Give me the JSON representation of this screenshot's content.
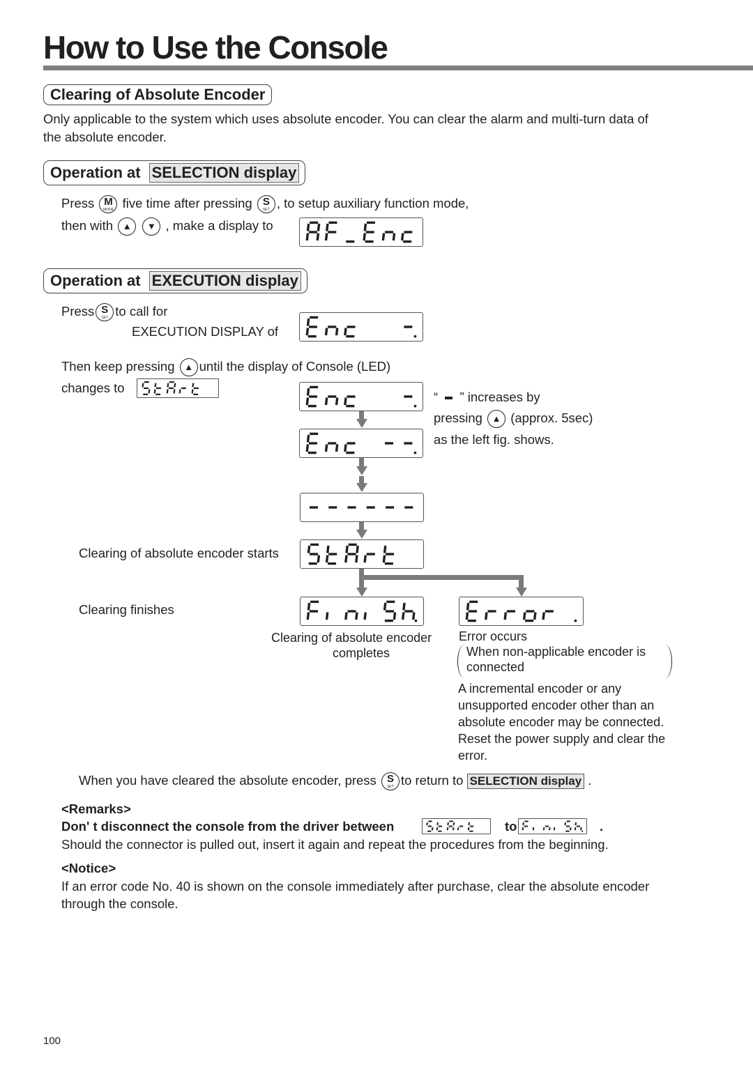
{
  "page": {
    "title": "How to Use the Console",
    "page_number": "100"
  },
  "section_clear": {
    "heading": "Clearing of Absolute Encoder",
    "intro_line1": "Only applicable to the system which uses absolute encoder. You can clear the alarm and multi-turn data of",
    "intro_line2": "the absolute encoder."
  },
  "section_selection": {
    "heading_prefix": "Operation at",
    "heading_tag": "SELECTION display",
    "line1_a": "Press",
    "line1_b": "five time after pressing",
    "line1_c": ", to setup auxiliary function mode,",
    "line2_a": "then with",
    "line2_b": ", make a display to",
    "display": "AF_Enc"
  },
  "section_execution": {
    "heading_prefix": "Operation at",
    "heading_tag": "EXECUTION display",
    "press_a": "Press",
    "press_b": "to call for",
    "exec_display_label": "EXECUTION DISPLAY of",
    "then_a": "Then keep pressing",
    "then_b": "until the display of Console (LED)",
    "changes_to": "changes to",
    "note_line1_open": "“",
    "note_line1_close": "” increases by",
    "note_line2_a": "pressing",
    "note_line2_b": "(approx. 5sec)",
    "note_line3": "as the left fig. shows.",
    "starts_label": "Clearing of absolute encoder starts",
    "finishes_label": "Clearing finishes",
    "complete_line1": "Clearing of absolute encoder",
    "complete_line2": "completes",
    "error_title": "Error occurs",
    "error_paren_line1": "When non-applicable encoder is",
    "error_paren_line2": "connected",
    "error_detail": [
      "A incremental encoder or any",
      "unsupported encoder other than an",
      "absolute encoder may be connected.",
      "Reset the power supply and clear the",
      "error."
    ],
    "return_a": "When you have cleared the absolute encoder, press",
    "return_b": "to return to",
    "return_tag": "SELECTION display",
    "return_end": "."
  },
  "buttons": {
    "mode": {
      "glyph": "M",
      "sub": "MODE",
      "icon": "mode-button-icon"
    },
    "set": {
      "glyph": "S",
      "sub": "SET",
      "icon": "set-button-icon"
    },
    "up": {
      "glyph": "▲",
      "icon": "up-button-icon"
    },
    "down": {
      "glyph": "▼",
      "icon": "down-button-icon"
    }
  },
  "remarks": {
    "heading": "<Remarks>",
    "bold_a": "Don' t disconnect the console from the driver between",
    "bold_b": "to",
    "bold_end": ".",
    "text": "Should the connector is pulled out, insert it again and repeat the procedures from the beginning."
  },
  "notice": {
    "heading": "<Notice>",
    "line1": "If an error code No. 40 is shown on the console immediately after purchase, clear the absolute encoder",
    "line2": "through the console."
  },
  "displays": {
    "af_enc": {
      "text": "AF_Enc",
      "digits": [
        "abcefg",
        "aefg",
        "d",
        "adefg",
        "ceg",
        "deg"
      ],
      "dp": [
        false,
        false,
        false,
        false,
        false,
        false
      ]
    },
    "enc1": {
      "text": "Enc   -.",
      "digits": [
        "adefg",
        "ceg",
        "deg",
        "",
        "",
        "g"
      ],
      "dp": [
        false,
        false,
        false,
        false,
        false,
        true
      ]
    },
    "enc2": {
      "text": "Enc  --.",
      "digits": [
        "adefg",
        "ceg",
        "deg",
        "",
        "g",
        "g"
      ],
      "dp": [
        false,
        false,
        false,
        false,
        false,
        true
      ]
    },
    "dashes": {
      "text": "------",
      "digits": [
        "g",
        "g",
        "g",
        "g",
        "g",
        "g"
      ],
      "dp": [
        false,
        false,
        false,
        false,
        false,
        false
      ]
    },
    "start": {
      "text": "StArt",
      "digits": [
        "acdfg",
        "defg",
        "abcefg",
        "eg",
        "defg",
        ""
      ],
      "dp": [
        false,
        false,
        false,
        false,
        false,
        false
      ]
    },
    "finish": {
      "text": "Finish.",
      "digits": [
        "aefg",
        "e",
        "ceg",
        "e",
        "acdfg",
        "cefg"
      ],
      "dp": [
        false,
        false,
        false,
        false,
        false,
        true
      ]
    },
    "error": {
      "text": "Error .",
      "digits": [
        "adefg",
        "eg",
        "eg",
        "cdeg",
        "eg",
        ""
      ],
      "dp": [
        false,
        false,
        false,
        false,
        false,
        true
      ]
    },
    "dash_glyph": {
      "text": "-"
    }
  },
  "colors": {
    "rule": "#808080",
    "arrow": "#7a7a7a",
    "tag_bg": "#e6e6e6",
    "text": "#231f20"
  }
}
